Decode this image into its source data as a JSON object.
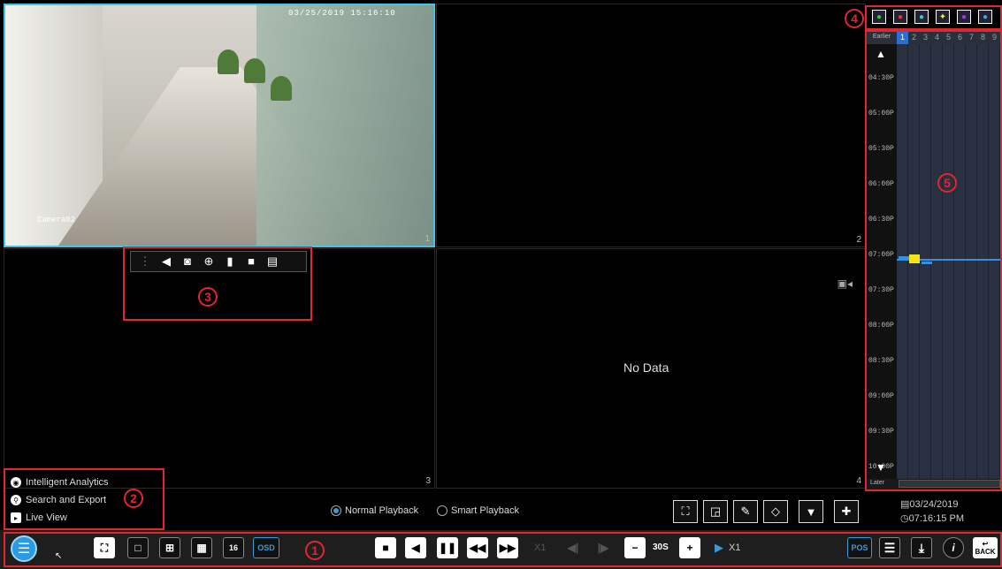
{
  "camera1": {
    "timestamp": "03/25/2019 15:16:10",
    "name": "Camera02",
    "index": "1"
  },
  "tiles": {
    "t2": "2",
    "t3": "3",
    "t4": "4"
  },
  "no_data": "No Data",
  "annotations": {
    "a1": "1",
    "a2": "2",
    "a3": "3",
    "a4": "4",
    "a5": "5"
  },
  "quick_toolbar": {
    "icons": [
      "drag-handle-icon",
      "mute-icon",
      "snapshot-icon",
      "zoom-icon",
      "bookmark-icon",
      "record-icon",
      "backup-icon"
    ]
  },
  "timeline": {
    "channels": [
      "1",
      "2",
      "3",
      "4",
      "5",
      "6",
      "7",
      "8",
      "9"
    ],
    "selected_channel": "1",
    "earlier": "Earlier",
    "later": "Later",
    "labels": [
      "04:30P",
      "05:00P",
      "05:30P",
      "06:00P",
      "06:30P",
      "07:00P",
      "07:30P",
      "08:00P",
      "08:30P",
      "09:00P",
      "09:30P",
      "10:00P"
    ],
    "date": "03/24/2019",
    "time": "07:16:15 PM"
  },
  "menu": {
    "intelligent": "Intelligent Analytics",
    "search": "Search and Export",
    "live": "Live View"
  },
  "playback_mode": {
    "normal": "Normal Playback",
    "smart": "Smart Playback",
    "selected": "normal"
  },
  "bottom": {
    "osd": "OSD",
    "speed1": "X1",
    "step": "30S",
    "speed2": "X1",
    "pos": "POS",
    "back": "BACK",
    "split16": "16"
  },
  "colors": {
    "accent": "#3fc6e6",
    "annotation": "#e0262f",
    "timeline_record": "#3a8ee0",
    "motion": "#f5e31a"
  }
}
